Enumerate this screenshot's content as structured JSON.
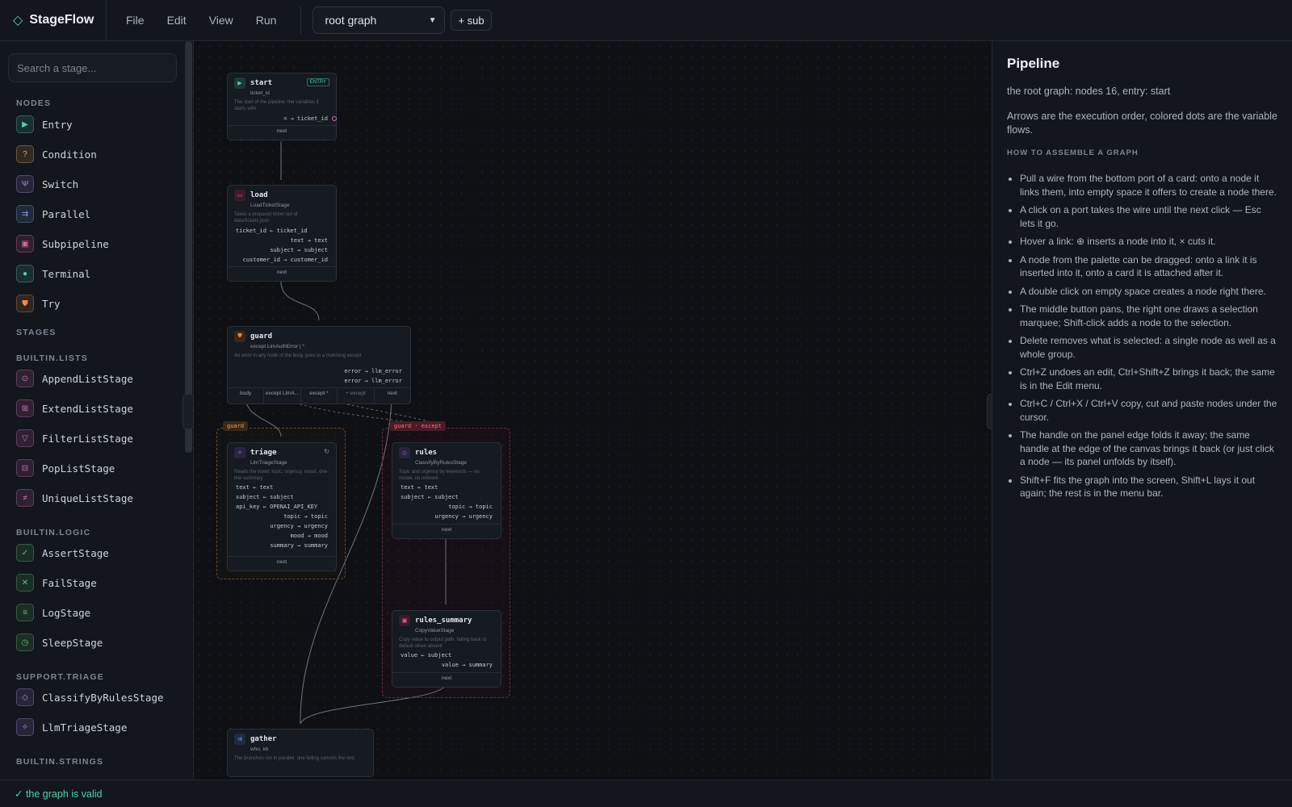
{
  "app": {
    "name": "StageFlow",
    "logo_icon": "diamond-icon"
  },
  "menu": [
    "File",
    "Edit",
    "View",
    "Run"
  ],
  "graph_select": {
    "value": "root graph"
  },
  "sub_button": "+ sub",
  "search": {
    "placeholder": "Search a stage..."
  },
  "palette": {
    "nodes_title": "NODES",
    "nodes": [
      {
        "label": "Entry",
        "icon": "play-icon",
        "color": "#4fd1b0"
      },
      {
        "label": "Condition",
        "icon": "question-icon",
        "color": "#e0b050"
      },
      {
        "label": "Switch",
        "icon": "fork-icon",
        "color": "#a98cf0"
      },
      {
        "label": "Parallel",
        "icon": "parallel-icon",
        "color": "#7d9bf0"
      },
      {
        "label": "Subpipeline",
        "icon": "subpipeline-icon",
        "color": "#e06a9a"
      },
      {
        "label": "Terminal",
        "icon": "terminal-icon",
        "color": "#4fd1b0"
      },
      {
        "label": "Try",
        "icon": "shield-icon",
        "color": "#f08a4b"
      }
    ],
    "stages_title": "STAGES",
    "groups": [
      {
        "title": "BUILTIN.LISTS",
        "items": [
          {
            "label": "AppendListStage",
            "icon": "append-icon",
            "color": "#d070c0"
          },
          {
            "label": "ExtendListStage",
            "icon": "grid-icon",
            "color": "#d070c0"
          },
          {
            "label": "FilterListStage",
            "icon": "filter-icon",
            "color": "#d070c0"
          },
          {
            "label": "PopListStage",
            "icon": "pop-icon",
            "color": "#d070c0"
          },
          {
            "label": "UniqueListStage",
            "icon": "unique-icon",
            "color": "#d070c0"
          }
        ]
      },
      {
        "title": "BUILTIN.LOGIC",
        "items": [
          {
            "label": "AssertStage",
            "icon": "check-icon",
            "color": "#5cc070"
          },
          {
            "label": "FailStage",
            "icon": "x-icon",
            "color": "#5cc070"
          },
          {
            "label": "LogStage",
            "icon": "list-icon",
            "color": "#5cc070"
          },
          {
            "label": "SleepStage",
            "icon": "clock-icon",
            "color": "#5cc070"
          }
        ]
      },
      {
        "title": "SUPPORT.TRIAGE",
        "items": [
          {
            "label": "ClassifyByRulesStage",
            "icon": "tag-icon",
            "color": "#a98cf0"
          },
          {
            "label": "LlmTriageStage",
            "icon": "sparkle-icon",
            "color": "#a98cf0"
          }
        ]
      },
      {
        "title": "BUILTIN.STRINGS",
        "items": []
      }
    ]
  },
  "nodes": {
    "start": {
      "title": "start",
      "sub": "ticket_id",
      "desc": "The start of the pipeline: the variables it starts with",
      "badge": "ENTRY",
      "ports": [
        "= → ticket_id"
      ],
      "foot": "next"
    },
    "load": {
      "title": "load",
      "sub": "LoadTicketStage",
      "desc": "Takes a prepared ticket out of data/tickets.json",
      "in": [
        "ticket_id ← ticket_id"
      ],
      "ports": [
        "text → text",
        "subject → subject",
        "customer_id → customer_id"
      ],
      "foot": "next"
    },
    "guard": {
      "title": "guard",
      "sub": "except LlmAuthError | *",
      "desc": "An error in any node of the body goes to a matching except",
      "ports": [
        "error → llm_error",
        "error → llm_error"
      ],
      "tabs": [
        "body",
        "except LlmA...",
        "except *",
        "+ except",
        "next"
      ]
    },
    "triage": {
      "title": "triage",
      "sub": "LlmTriageStage",
      "desc": "Reads the ticket: topic, urgency, mood, one-line summary",
      "in": [
        "text ← text",
        "subject ← subject",
        "api_key ← OPENAI_API_KEY"
      ],
      "ports": [
        "topic → topic",
        "urgency → urgency",
        "mood → mood",
        "summary → summary"
      ],
      "foot": "next"
    },
    "rules": {
      "title": "rules",
      "sub": "ClassifyByRulesStage",
      "desc": "Topic and urgency by keywords — no model, no network",
      "in": [
        "text ← text",
        "subject ← subject"
      ],
      "ports": [
        "topic → topic",
        "urgency → urgency"
      ],
      "foot": "next"
    },
    "rules_summary": {
      "title": "rules_summary",
      "sub": "CopyValueStage",
      "desc": "Copy value to output path, falling back to default when absent",
      "in": [
        "value ← subject"
      ],
      "ports": [
        "value → summary"
      ],
      "foot": "next"
    },
    "gather": {
      "title": "gather",
      "sub": "who, kb",
      "desc": "The branches run in parallel: one failing cancels the rest"
    }
  },
  "groups": {
    "guard_body": "guard",
    "guard_except": "guard · except"
  },
  "panel": {
    "title": "Pipeline",
    "summary": "the root graph: nodes 16, entry: start",
    "legend": "Arrows are the execution order, colored dots are the variable flows.",
    "howto_title": "HOW TO ASSEMBLE A GRAPH",
    "tips": [
      "Pull a wire from the bottom port of a card: onto a node it links them, into empty space it offers to create a node there.",
      "A click on a port takes the wire until the next click — Esc lets it go.",
      "Hover a link: ⊕ inserts a node into it, × cuts it.",
      "A node from the palette can be dragged: onto a link it is inserted into it, onto a card it is attached after it.",
      "A double click on empty space creates a node right there.",
      "The middle button pans, the right one draws a selection marquee; Shift-click adds a node to the selection.",
      "Delete removes what is selected: a single node as well as a whole group.",
      "Ctrl+Z undoes an edit, Ctrl+Shift+Z brings it back; the same is in the Edit menu.",
      "Ctrl+C / Ctrl+X / Ctrl+V copy, cut and paste nodes under the cursor.",
      "The handle on the panel edge folds it away; the same handle at the edge of the canvas brings it back (or just click a node — its panel unfolds by itself).",
      "Shift+F fits the graph into the screen, Shift+L lays it out again; the rest is in the menu bar."
    ]
  },
  "status": "✓ the graph is valid"
}
